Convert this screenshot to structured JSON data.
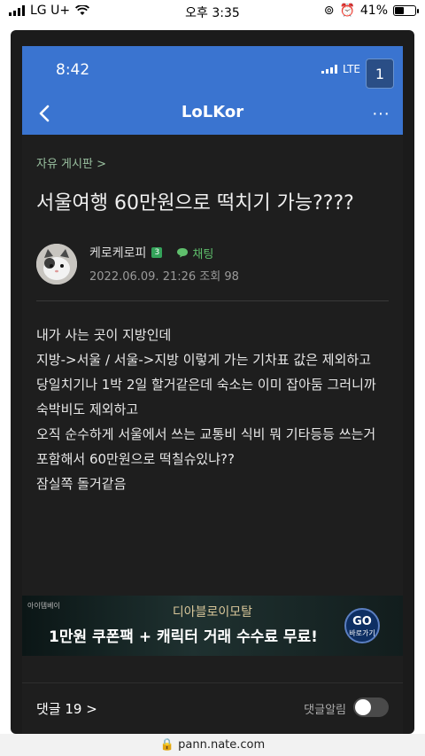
{
  "outer_status": {
    "carrier": "LG U+",
    "time": "오후 3:35",
    "battery": "41%",
    "battery_level": 0.41
  },
  "browser": {
    "url": "pann.nate.com"
  },
  "inner_status": {
    "time": "8:42",
    "network": "LTE",
    "tab_count": "1"
  },
  "app_bar": {
    "title": "LoLKor",
    "more": "···"
  },
  "post": {
    "board": "자유 게시판 >",
    "title": "서울여행 60만원으로 떡치기 가능????",
    "author": "케로케로피",
    "author_level": "3",
    "chat_label": "채팅",
    "meta": "2022.06.09. 21:26  조회 98",
    "body_lines": [
      "내가 사는 곳이 지방인데",
      "지방->서울 / 서울->지방 이렇게 가는 기차표 값은 제외하고",
      "당일치기나 1박 2일 할거같은데 숙소는 이미 잡아둠 그러니까 숙박비도 제외하고",
      "오직 순수하게 서울에서 쓰는 교통비 식비 뭐 기타등등 쓰는거 포함해서 60만원으로 떡칠슈있냐??",
      "잠실쪽 돌거같음"
    ]
  },
  "ad": {
    "brand": "아이템베이",
    "subtitle": "디아블로이모탈",
    "headline": "1만원 쿠폰팩 + 캐릭터 거래 수수료 무료!",
    "go": "GO",
    "go_sub": "바로가기"
  },
  "comments": {
    "count_label": "댓글 19 >",
    "notify_label": "댓글알림"
  },
  "colors": {
    "accent_blue": "#3a74d0",
    "search_red": "#e53935",
    "board_green": "#9ac1a0"
  }
}
